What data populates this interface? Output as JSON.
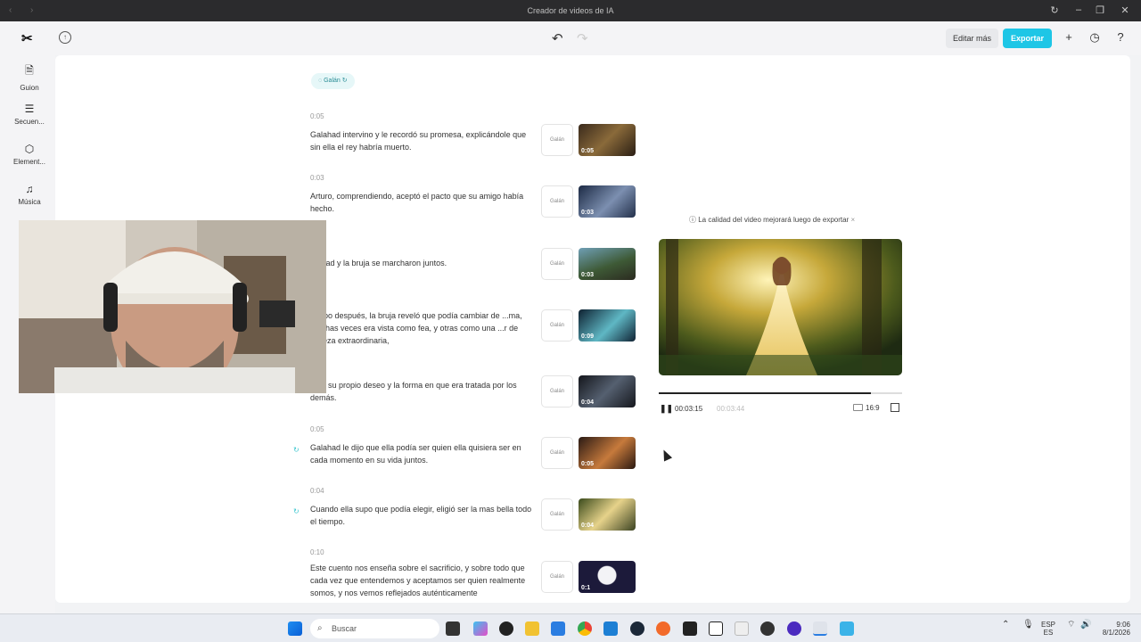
{
  "window": {
    "title": "Creador de videos de IA"
  },
  "header": {
    "edit_more": "Editar más",
    "export": "Exportar"
  },
  "sidebar": {
    "items": [
      {
        "label": "Guion"
      },
      {
        "label": "Secuen..."
      },
      {
        "label": "Element..."
      },
      {
        "label": "Música"
      }
    ]
  },
  "voice": {
    "label": "Galán"
  },
  "scenes": [
    {
      "time": "0:05",
      "text": "Galahad intervino y le recordó su promesa, explicándole que sin ella el rey habría muerto.",
      "voice": "Galán",
      "duration": "0:05"
    },
    {
      "time": "0:03",
      "text": "Arturo, comprendiendo, aceptó el pacto que su amigo había hecho.",
      "voice": "Galán",
      "duration": "0:03"
    },
    {
      "time": "",
      "text": "...ahad y la bruja se marcharon juntos.",
      "voice": "Galán",
      "duration": "0:03"
    },
    {
      "time": "",
      "text": "...mpo después, la bruja reveló que podía cambiar de ...ma, muchas veces era vista como fea, y otras como una ...r de belleza extraordinaria,",
      "voice": "Galán",
      "duration": "0:09"
    },
    {
      "time": "",
      "text": "...ún su propio deseo y la forma en que era tratada por los demás.",
      "voice": "Galán",
      "duration": "0:04"
    },
    {
      "time": "0:05",
      "text": "Galahad le dijo que ella podía ser quien ella quisiera ser en cada momento en su vida juntos.",
      "voice": "Galán",
      "duration": "0:05"
    },
    {
      "time": "0:04",
      "text": "Cuando ella supo que podía elegir, eligió ser la mas bella todo el tiempo.",
      "voice": "Galán",
      "duration": "0:04"
    },
    {
      "time": "0:10",
      "text": "Este cuento nos enseña sobre el sacrificio, y sobre todo que cada vez que entendemos y aceptamos ser quien realmente somos, y nos vemos reflejados auténticamente",
      "voice": "Galán",
      "duration": "0:1"
    }
  ],
  "preview": {
    "quality_note": "La calidad del video mejorará luego de exportar",
    "current_time": "00:03:15",
    "total_time": "00:03:44",
    "progress": 0.87,
    "aspect_ratio": "16:9"
  },
  "taskbar": {
    "search_placeholder": "Buscar",
    "lang_top": "ESP",
    "lang_bottom": "ES",
    "time": "9:06",
    "date": "8/1/2026"
  }
}
